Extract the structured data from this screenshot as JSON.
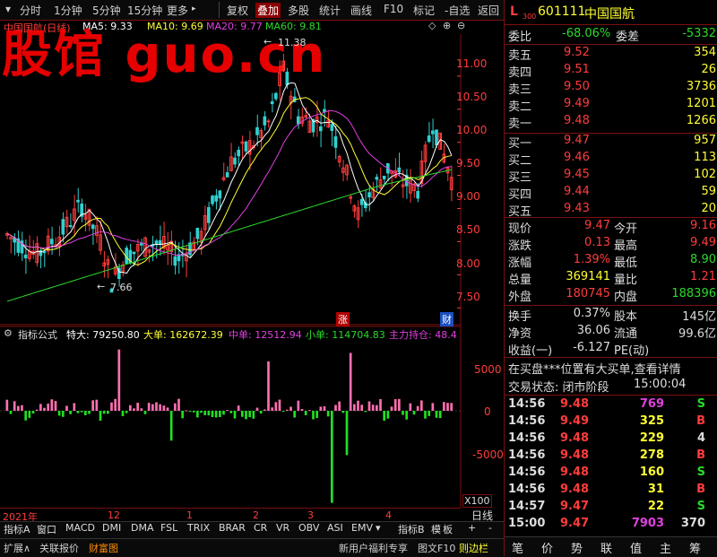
{
  "toolbar": {
    "items": [
      "分时",
      "1分钟",
      "5分钟",
      "15分钟",
      "更多",
      "复权",
      "叠加",
      "多股",
      "统计",
      "画线",
      "F10",
      "标记",
      "-自选",
      "返回"
    ],
    "active": "叠加",
    "more_arrow": "▸"
  },
  "chart": {
    "title": "中国国航(日线)",
    "ma": [
      {
        "label": "MA5: 9.33",
        "color": "#ffffff"
      },
      {
        "label": "MA10: 9.69",
        "color": "#ffff33"
      },
      {
        "label": "MA20: 9.77",
        "color": "#e040e0"
      },
      {
        "label": "MA60: 9.81",
        "color": "#2bd92b"
      }
    ],
    "watermark": "股馆 guo.cn",
    "price_axis": [
      "11.00",
      "10.50",
      "10.00",
      "9.50",
      "9.00",
      "8.50",
      "8.00",
      "7.50"
    ],
    "high_label": "11.38",
    "low_label": "7.66",
    "zhang_badge": "涨",
    "cai_badge": "财"
  },
  "indicator": {
    "name": "指标公式",
    "label_te": "特大: 79250.80",
    "label_da": "大单: 162672.39",
    "label_zhong": "中单: 12512.94",
    "label_xiao": "小单: 114704.83",
    "label_zhuli": "主力持仓: 48.4",
    "axis": [
      "5000",
      "0",
      "-5000"
    ],
    "scale": "X100"
  },
  "date_axis": {
    "labels": [
      "2021年",
      "12",
      "1",
      "2",
      "3",
      "4"
    ],
    "tool": "日线"
  },
  "indicator_tabs": [
    "指标A",
    "窗口",
    "MACD",
    "DMI",
    "DMA",
    "FSL",
    "TRIX",
    "BRAR",
    "CR",
    "VR",
    "OBV",
    "ASI",
    "EMV",
    "指标B",
    "模",
    "板",
    "+",
    "-"
  ],
  "bottom_bar": {
    "left": [
      "扩展∧",
      "关联报价",
      "财富图"
    ],
    "right": [
      "新用户福利专享",
      "图文F10",
      "则边栏"
    ],
    "right_tabs": [
      "笔",
      "价",
      "势",
      "联",
      "值",
      "主",
      "筹"
    ]
  },
  "quote": {
    "code": "601111",
    "name": "中国国航",
    "l_mark": "L",
    "sub": "300",
    "weibi_label": "委比",
    "weibi": "-68.06%",
    "weicha_label": "委差",
    "weicha": "-5332",
    "asks": [
      {
        "label": "卖五",
        "price": "9.52",
        "vol": "354"
      },
      {
        "label": "卖四",
        "price": "9.51",
        "vol": "26"
      },
      {
        "label": "卖三",
        "price": "9.50",
        "vol": "3736"
      },
      {
        "label": "卖二",
        "price": "9.49",
        "vol": "1201"
      },
      {
        "label": "卖一",
        "price": "9.48",
        "vol": "1266"
      }
    ],
    "bids": [
      {
        "label": "买一",
        "price": "9.47",
        "vol": "957"
      },
      {
        "label": "买二",
        "price": "9.46",
        "vol": "113"
      },
      {
        "label": "买三",
        "price": "9.45",
        "vol": "102"
      },
      {
        "label": "买四",
        "price": "9.44",
        "vol": "59"
      },
      {
        "label": "买五",
        "price": "9.43",
        "vol": "20"
      }
    ],
    "stats": [
      {
        "l1": "现价",
        "v1": "9.47",
        "c1": "red",
        "l2": "今开",
        "v2": "9.16",
        "c2": "red"
      },
      {
        "l1": "涨跌",
        "v1": "0.13",
        "c1": "red",
        "l2": "最高",
        "v2": "9.49",
        "c2": "red"
      },
      {
        "l1": "涨幅",
        "v1": "1.39%",
        "c1": "red",
        "l2": "最低",
        "v2": "8.90",
        "c2": "green"
      },
      {
        "l1": "总量",
        "v1": "369141",
        "c1": "yellow",
        "l2": "量比",
        "v2": "1.21",
        "c2": "red"
      },
      {
        "l1": "外盘",
        "v1": "180745",
        "c1": "red",
        "l2": "内盘",
        "v2": "188396",
        "c2": "green"
      }
    ],
    "stats2": [
      {
        "l1": "换手",
        "v1": "0.37%",
        "l2": "股本",
        "v2": "145亿"
      },
      {
        "l1": "净资",
        "v1": "36.06",
        "l2": "流通",
        "v2": "99.6亿"
      },
      {
        "l1": "收益(一)",
        "v1": "-6.127",
        "l2": "PE(动)",
        "v2": ""
      }
    ],
    "notice": "在买盘***位置有大买单,查看详情",
    "status_label": "交易状态: 闭市阶段",
    "status_time": "15:00:04",
    "ticks": [
      {
        "t": "14:56",
        "p": "9.48",
        "v": "769",
        "d": "S",
        "vc": "magenta"
      },
      {
        "t": "14:56",
        "p": "9.49",
        "v": "325",
        "d": "B",
        "vc": "yellow"
      },
      {
        "t": "14:56",
        "p": "9.48",
        "v": "229",
        "d": "4",
        "vc": "yellow"
      },
      {
        "t": "14:56",
        "p": "9.48",
        "v": "278",
        "d": "B",
        "vc": "yellow"
      },
      {
        "t": "14:56",
        "p": "9.48",
        "v": "160",
        "d": "S",
        "vc": "yellow"
      },
      {
        "t": "14:56",
        "p": "9.48",
        "v": "31",
        "d": "B",
        "vc": "yellow"
      },
      {
        "t": "14:57",
        "p": "9.47",
        "v": "22",
        "d": "S",
        "vc": "yellow"
      },
      {
        "t": "15:00",
        "p": "9.47",
        "v": "7903",
        "d": "370",
        "vc": "magenta"
      }
    ]
  },
  "colors": {
    "up": "#ff3c3c",
    "down": "#2bd92b",
    "cyan": "#30d0d0",
    "border": "#7a1010"
  }
}
